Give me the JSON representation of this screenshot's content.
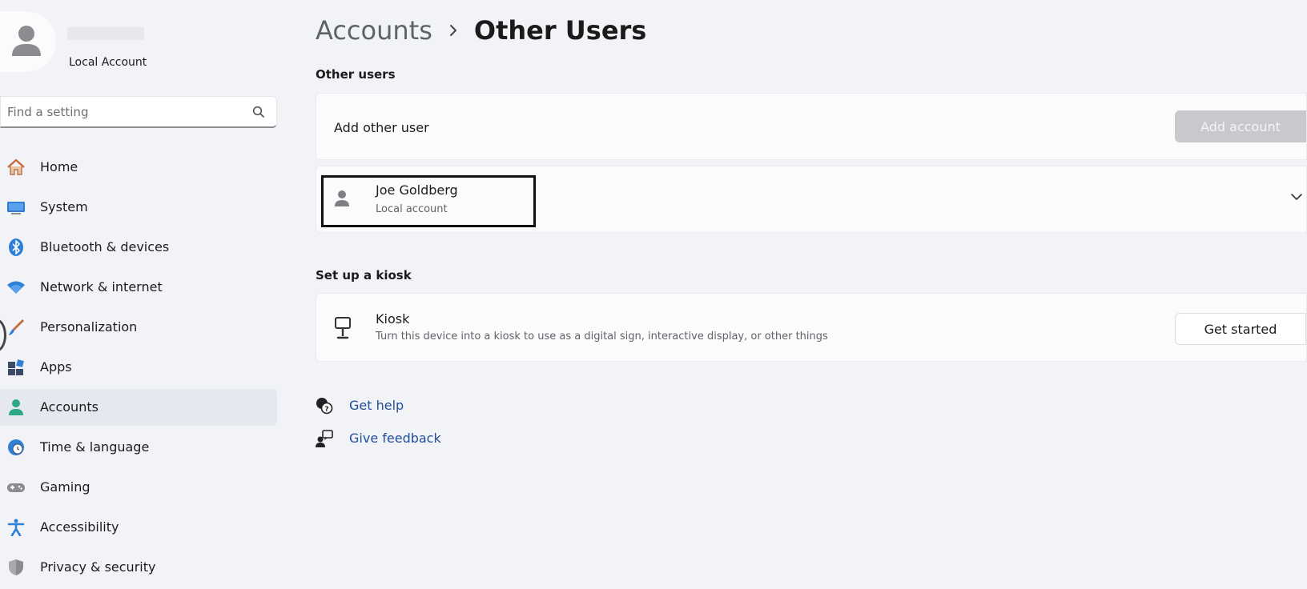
{
  "profile": {
    "account_type": "Local Account"
  },
  "search": {
    "placeholder": "Find a setting"
  },
  "sidebar": {
    "items": [
      {
        "label": "Home",
        "icon": "home-icon"
      },
      {
        "label": "System",
        "icon": "system-icon"
      },
      {
        "label": "Bluetooth & devices",
        "icon": "bluetooth-icon"
      },
      {
        "label": "Network & internet",
        "icon": "wifi-icon"
      },
      {
        "label": "Personalization",
        "icon": "brush-icon"
      },
      {
        "label": "Apps",
        "icon": "apps-icon"
      },
      {
        "label": "Accounts",
        "icon": "accounts-icon"
      },
      {
        "label": "Time & language",
        "icon": "globe-clock-icon"
      },
      {
        "label": "Gaming",
        "icon": "gamepad-icon"
      },
      {
        "label": "Accessibility",
        "icon": "accessibility-icon"
      },
      {
        "label": "Privacy & security",
        "icon": "shield-icon"
      }
    ],
    "active_index": 6
  },
  "header": {
    "parent": "Accounts",
    "separator": "›",
    "current": "Other Users"
  },
  "other_users": {
    "section_title": "Other users",
    "add_label": "Add other user",
    "add_button": "Add account",
    "user": {
      "name": "Joe Goldberg",
      "account_type": "Local account"
    }
  },
  "kiosk": {
    "section_title": "Set up a kiosk",
    "title": "Kiosk",
    "description": "Turn this device into a kiosk to use as a digital sign, interactive display, or other things",
    "button": "Get started"
  },
  "links": {
    "help": "Get help",
    "feedback": "Give feedback"
  },
  "colors": {
    "background": "#f1f3f7",
    "card": "#fbfbfc",
    "link": "#1f4e9a",
    "accent": "#2f7fd6",
    "disabled_button": "#c7c9cc"
  }
}
